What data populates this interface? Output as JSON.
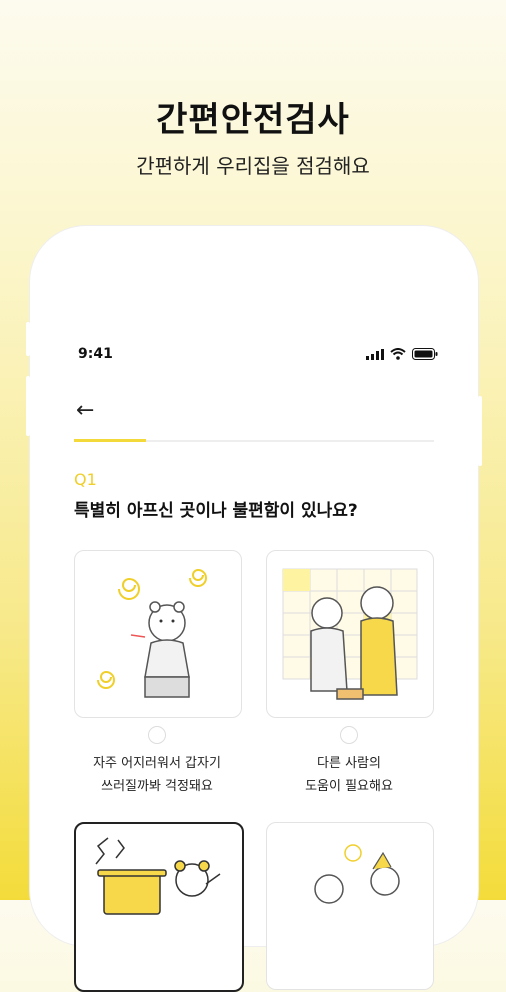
{
  "promo": {
    "title": "간편안전검사",
    "subtitle": "간편하게 우리집을 점검해요"
  },
  "status_bar": {
    "time": "9:41",
    "icons": [
      "signal-icon",
      "wifi-icon",
      "battery-icon"
    ]
  },
  "header": {
    "back_icon": "arrow-left-icon",
    "back_glyph": "←"
  },
  "progress": {
    "value": 0.2
  },
  "question": {
    "number": "Q1",
    "text": "특별히 아프신 곳이나 불편함이 있나요?"
  },
  "options": [
    {
      "line1": "자주 어지러워서 갑자기",
      "line2": "쓰러질까봐 걱정돼요"
    },
    {
      "line1": "다른 사람의",
      "line2": "도움이 필요해요"
    }
  ],
  "colors": {
    "accent": "#f4d93a",
    "question_number": "#f0cf2a",
    "text": "#111111"
  }
}
